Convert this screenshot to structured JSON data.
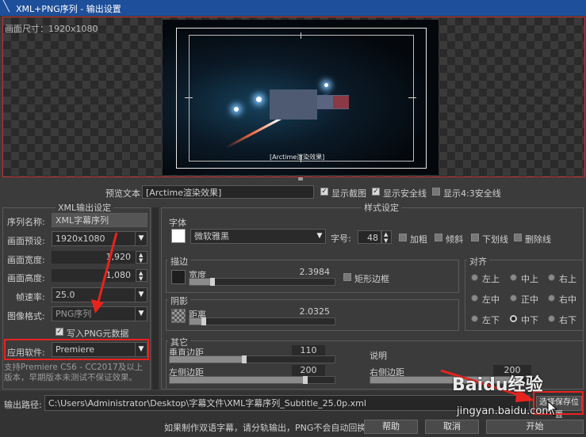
{
  "window": {
    "title": "XML+PNG序列 - 输出设置"
  },
  "preview": {
    "canvas_size_label": "画面尺寸：1920x1080",
    "video_caption": "[Arctime渲染效果]"
  },
  "preview_options": {
    "preview_text_label": "预览文本",
    "preview_text_value": "[Arctime渲染效果]",
    "show_screenshot": {
      "label": "显示截图",
      "checked": true
    },
    "show_safe_lines": {
      "label": "显示安全线",
      "checked": true
    },
    "show_43_safe_lines": {
      "label": "显示4:3安全线",
      "checked": false
    }
  },
  "xml_settings": {
    "group_title": "XML输出设定",
    "sequence_name_label": "序列名称:",
    "sequence_name_value": "XML字幕序列",
    "preset_label": "画面预设:",
    "preset_value": "1920x1080",
    "width_label": "画面宽度:",
    "width_value": "1,920",
    "height_label": "画面高度:",
    "height_value": "1,080",
    "fps_label": "帧速率:",
    "fps_value": "25.0",
    "image_format_label": "图像格式:",
    "image_format_value": "PNG序列",
    "write_png_meta": {
      "label": "写入PNG元数据",
      "checked": true
    },
    "app_label": "应用软件:",
    "app_value": "Premiere",
    "note": "支持Premiere CS6 - CC2017及以上版本，早期版本未测试不保证效果。"
  },
  "style_settings": {
    "group_title": "样式设定",
    "font_group": "字体",
    "font_color": "#ffffff",
    "font_value": "微软雅黑",
    "size_label": "字号:",
    "size_value": "48",
    "bold_label": "加粗",
    "italic_label": "倾斜",
    "underline_label": "下划线",
    "strike_label": "删除线",
    "stroke_group": "描边",
    "stroke_color": "#1e1e1e",
    "stroke_width_label": "宽度",
    "stroke_width_value": "2.3984",
    "stroke_width_fraction": 0.16,
    "rect_border_label": "矩形边框",
    "shadow_group": "阴影",
    "shadow_distance_label": "距离",
    "shadow_distance_value": "2.0325",
    "shadow_distance_fraction": 0.1,
    "align_group": "对齐",
    "align_options": [
      "左上",
      "中上",
      "右上",
      "左中",
      "正中",
      "右中",
      "左下",
      "中下",
      "右下"
    ],
    "align_selected": "中下",
    "other_group": "其它",
    "v_margin_label": "垂直边距",
    "v_margin_value": "110",
    "v_margin_fraction": 0.45,
    "left_margin_label": "左侧边距",
    "left_margin_value": "200",
    "left_margin_fraction": 0.82,
    "note_label": "说明",
    "right_margin_label": "右侧边距",
    "right_margin_value": "200",
    "right_margin_fraction": 0.9
  },
  "output": {
    "path_label": "输出路径:",
    "path_value": "C:\\Users\\Administrator\\Desktop\\字幕文件\\XML字幕序列_Subtitle_25.0p.xml",
    "choose_button": "选择保存位置"
  },
  "footer": {
    "hint": "如果制作双语字幕，请分轨输出，PNG不会自动回换行",
    "help_button": "帮助",
    "cancel_button": "取消",
    "start_button": "开始"
  },
  "watermark": {
    "brand": "Baidu经验",
    "url": "jingyan.baidu.com"
  }
}
